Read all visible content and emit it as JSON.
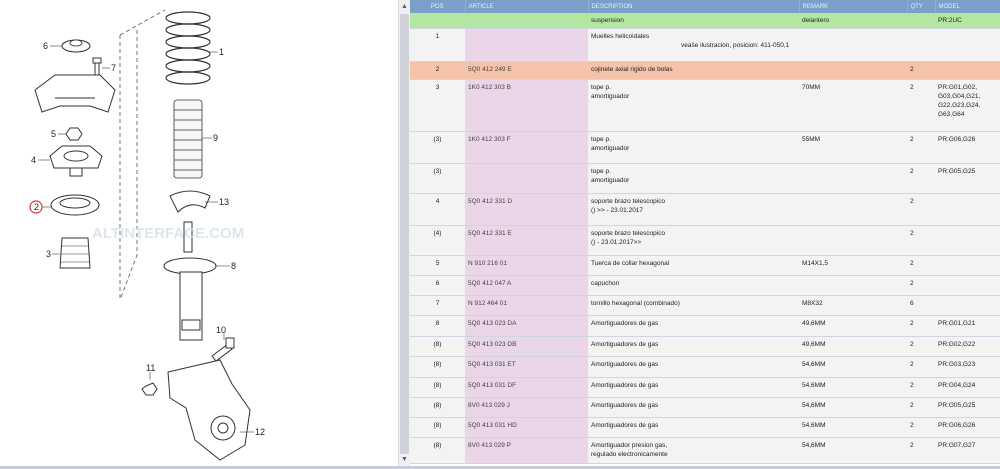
{
  "diagram": {
    "callouts": [
      "1",
      "2",
      "3",
      "4",
      "5",
      "6",
      "7",
      "8",
      "9",
      "10",
      "11",
      "12",
      "13"
    ],
    "watermark": "ALTINTERFACE.COM",
    "highlight_color": "#e03030"
  },
  "table": {
    "columns": [
      "POS",
      "ARTICLE",
      "DESCRIPTION",
      "REMARK",
      "QTY",
      "MODEL"
    ],
    "header_row": {
      "description": "suspension",
      "remark": "delantero",
      "model": "PR:2UC"
    },
    "rows": [
      {
        "pos": "1",
        "article": "",
        "desc": "Muelles helicoidales",
        "desc2": "",
        "note": "veaše ilustracion, posicion:  411-050,1",
        "remark": "",
        "qty": "",
        "model": "",
        "style": "grey"
      },
      {
        "pos": "2",
        "article": "5Q0 412 249 E",
        "desc": "cojinete axial rigido de bolas",
        "desc2": "",
        "note": "",
        "remark": "",
        "qty": "2",
        "model": "",
        "style": "hl"
      },
      {
        "pos": "3",
        "article": "1K0 412 303 B",
        "desc": "tope p.",
        "desc2": "amortiguador",
        "note": "",
        "remark": "70MM",
        "qty": "2",
        "model": "PR:G01,G02,\nG03,G04,G21,\nG22,G23,G24,\nG63,G64",
        "style": "grey"
      },
      {
        "pos": "(3)",
        "article": "1K0 412 303 F",
        "desc": "tope p.",
        "desc2": "amortiguador",
        "note": "",
        "remark": "55MM",
        "qty": "2",
        "model": "PR:G06,G26",
        "style": "grey"
      },
      {
        "pos": "(3)",
        "article": "",
        "desc": "tope p.",
        "desc2": "amortiguador",
        "note": "",
        "remark": "",
        "qty": "2",
        "model": "PR:G05,G25",
        "style": "grey"
      },
      {
        "pos": "4",
        "article": "5Q0 412 331 D",
        "desc": "soporte brazo telescopico",
        "desc2": "()          >> - 23.01.2017",
        "note": "",
        "remark": "",
        "qty": "2",
        "model": "",
        "style": "grey"
      },
      {
        "pos": "(4)",
        "article": "5Q0 412 331 E",
        "desc": "soporte brazo telescopico",
        "desc2": "() - 23.01.2017>>",
        "note": "",
        "remark": "",
        "qty": "2",
        "model": "",
        "style": "grey"
      },
      {
        "pos": "5",
        "article": "N   910 216 01",
        "desc": "Tuerca de collar hexagonal",
        "desc2": "",
        "note": "",
        "remark": "M14X1,5",
        "qty": "2",
        "model": "",
        "style": "grey"
      },
      {
        "pos": "6",
        "article": "5Q0 412 047 A",
        "desc": "capuchon",
        "desc2": "",
        "note": "",
        "remark": "",
        "qty": "2",
        "model": "",
        "style": "grey"
      },
      {
        "pos": "7",
        "article": "N   912 464 01",
        "desc": "tornillo hexagonal (combinado)",
        "desc2": "",
        "note": "",
        "remark": "M8X32",
        "qty": "6",
        "model": "",
        "style": "grey"
      },
      {
        "pos": "8",
        "article": "5Q0 413 023 DA",
        "desc": "Amortiguadores de gas",
        "desc2": "",
        "note": "",
        "remark": "49,6MM",
        "qty": "2",
        "model": "PR:G01,G21",
        "style": "grey"
      },
      {
        "pos": "(8)",
        "article": "5Q0 413 023 DB",
        "desc": "Amortiguadores de gas",
        "desc2": "",
        "note": "",
        "remark": "49,6MM",
        "qty": "2",
        "model": "PR:G02,G22",
        "style": "grey"
      },
      {
        "pos": "(8)",
        "article": "5Q0 413 031 ET",
        "desc": "Amortiguadores de gas",
        "desc2": "",
        "note": "",
        "remark": "54,6MM",
        "qty": "2",
        "model": "PR:G03,G23",
        "style": "grey"
      },
      {
        "pos": "(8)",
        "article": "5Q0 413 031 DF",
        "desc": "Amortiguadores de gas",
        "desc2": "",
        "note": "",
        "remark": "54,6MM",
        "qty": "2",
        "model": "PR:G04,G24",
        "style": "grey"
      },
      {
        "pos": "(8)",
        "article": "8V0 413 029 J",
        "desc": "Amortiguadores de gas",
        "desc2": "",
        "note": "",
        "remark": "54,6MM",
        "qty": "2",
        "model": "PR:G05,G25",
        "style": "grey"
      },
      {
        "pos": "(8)",
        "article": "5Q0 413 031 HD",
        "desc": "Amortiguadores de gas",
        "desc2": "",
        "note": "",
        "remark": "54,6MM",
        "qty": "2",
        "model": "PR:G06,G26",
        "style": "grey"
      },
      {
        "pos": "(8)",
        "article": "8V0 413 029 P",
        "desc": "Amortiguador presion gas,",
        "desc2": "regulado electronicamente",
        "note": "",
        "remark": "54,6MM",
        "qty": "2",
        "model": "PR:G07,G27",
        "style": "grey"
      }
    ]
  }
}
